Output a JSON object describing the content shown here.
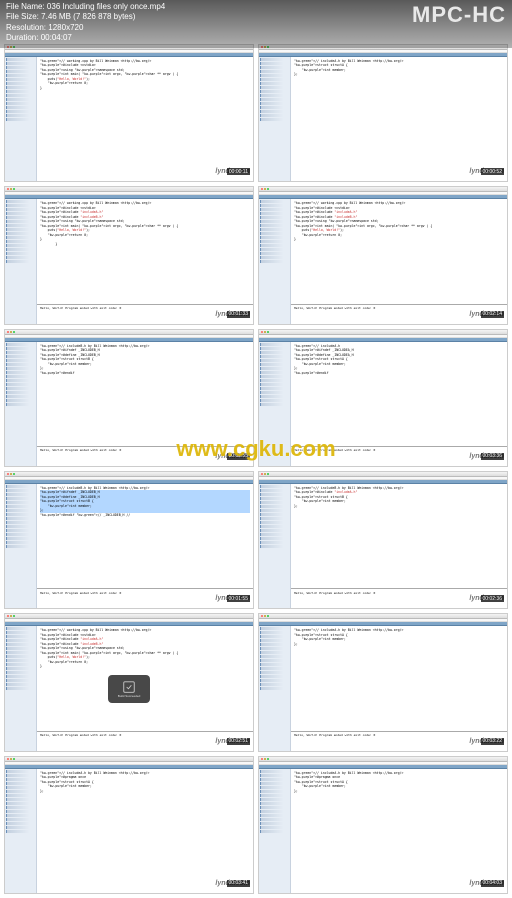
{
  "header": {
    "file_label": "File Name:",
    "file_name": "036 Including files only once.mp4",
    "size_label": "File Size:",
    "size_value": "7.46 MB (7 826 878 bytes)",
    "res_label": "Resolution:",
    "res_value": "1280x720",
    "dur_label": "Duration:",
    "dur_value": "00:04:07",
    "app_name": "MPC-HC"
  },
  "watermark_center": "www.cgku.com",
  "watermark_cell": "lynda.com",
  "cells": [
    {
      "timestamp": "00:00:11",
      "code": "// working.cpp by Bill Weinman <http://bw.org/>\n#include <cstdio>\nusing namespace std;\n\nint main( int argc, char ** argv ) {\n    puts(\"Hello, World!\");\n    return 0;\n}",
      "output": "",
      "highlight": false
    },
    {
      "timestamp": "00:00:52",
      "code": "// includeA.h by Bill Weinman <http://bw.org/>\n\nstruct structA {\n    int member;\n};",
      "output": "",
      "highlight": false
    },
    {
      "timestamp": "00:01:33",
      "code": "// working.cpp by Bill Weinman <http://bw.org/>\n#include <cstdio>\n#include \"includeA.h\"\n#include \"includeB.h\"\nusing namespace std;\n\nint main( int argc, char ** argv ) {\n    puts(\"Hello, World!\");\n    return 0;\n}\n\n        }",
      "output": "Hello, World!\nProgram ended with exit code: 0",
      "highlight": false
    },
    {
      "timestamp": "00:02:14",
      "code": "// working.cpp by Bill Weinman <http://bw.org/>\n#include <cstdio>\n#include \"includeA.h\"\n#include \"includeB.h\"\nusing namespace std;\n\nint main( int argc, char ** argv ) {\n    puts(\"Hello, World!\");\n    return 0;\n}",
      "output": "Hello, World!\nProgram ended with exit code: 0",
      "highlight": false
    },
    {
      "timestamp": "00:02:55",
      "code": "// includeB.h by Bill Weinman <http://bw.org/>\n\n#ifndef _INCLUDEB_H\n#define _INCLUDEB_H\n\nstruct structB {\n    int member;\n};\n\n#endif",
      "output": "Hello, World!\nProgram ended with exit code: 0",
      "highlight": false
    },
    {
      "timestamp": "00:03:36",
      "code": "// includeA.h\n\n#ifndef _INCLUDEA_H\n#define _INCLUDEA_H\n\nstruct structA {\n    int member;\n};\n\n#endif",
      "output": "Hello, World!\nProgram ended with exit code: 0",
      "highlight": false
    },
    {
      "timestamp": "00:01:55",
      "code": "// includeB.h by Bill Weinman <http://bw.org/>\n\n#ifndef _INCLUDEB_H\n#define _INCLUDEB_H\n\nstruct structB {\n    int member;\n};\n\n#endif // _INCLUDEB_H //",
      "output": "Hello, World!\nProgram ended with exit code: 0",
      "highlight": true
    },
    {
      "timestamp": "00:02:36",
      "code": "// includeB.h by Bill Weinman <http://bw.org/>\n\n#include \"includeA.h\"\n\nstruct structB {\n    int member;\n};",
      "output": "Hello, World!\nProgram ended with exit code: 0",
      "highlight": false
    },
    {
      "timestamp": "00:02:51",
      "code": "// working.cpp by Bill Weinman <http://bw.org/>\n#include <cstdio>\n#include \"includeA.h\"\n#include \"includeB.h\"\nusing namespace std;\n\nint main( int argc, char ** argv ) {\n    puts(\"Hello, World!\");\n    return 0;\n}",
      "output": "Hello, World!\nProgram ended with exit code: 0",
      "highlight": false,
      "build_toast": true,
      "build_label": "Build Succeeded"
    },
    {
      "timestamp": "00:03:22",
      "code": "// includeA.h by Bill Weinman <http://bw.org/>\n\nstruct structA {\n    int member;\n};",
      "output": "Hello, World!\nProgram ended with exit code: 0",
      "highlight": false
    },
    {
      "timestamp": "00:03:41",
      "code": "// includeA.h by Bill Weinman <http://bw.org/>\n#pragma once\n\nstruct structA {\n    int member;\n};",
      "output": "",
      "highlight": false
    },
    {
      "timestamp": "00:04:03",
      "code": "// includeA.h by Bill Weinman <http://bw.org/>\n#pragma once\n\nstruct structA {\n    int member;\n};",
      "output": "",
      "highlight": false
    }
  ]
}
